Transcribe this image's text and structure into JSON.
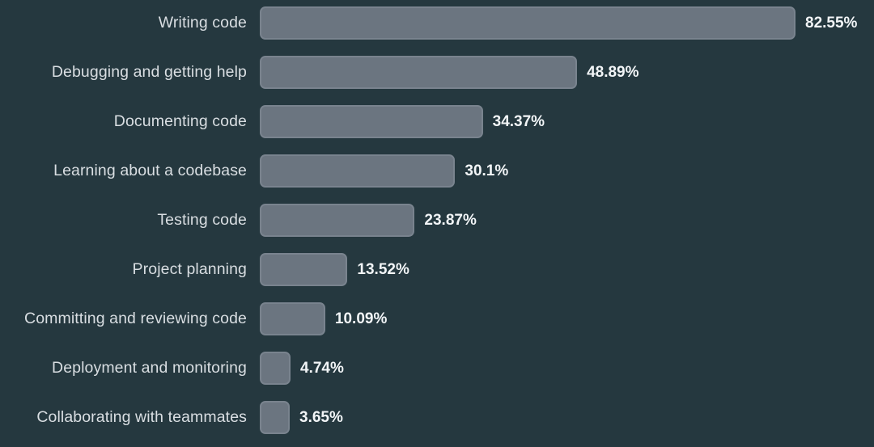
{
  "chart_data": {
    "type": "bar",
    "orientation": "horizontal",
    "title": "",
    "subtitle": "",
    "xlabel": "",
    "ylabel": "",
    "xlim": [
      0,
      82.55
    ],
    "grid": false,
    "legend": null,
    "value_suffix": "%",
    "categories": [
      "Writing code",
      "Debugging and getting help",
      "Documenting code",
      "Learning about a codebase",
      "Testing code",
      "Project planning",
      "Committing and reviewing code",
      "Deployment and monitoring",
      "Collaborating with teammates"
    ],
    "values": [
      82.55,
      48.89,
      34.37,
      30.1,
      23.87,
      13.52,
      10.09,
      4.74,
      3.65
    ],
    "value_labels": [
      "82.55%",
      "48.89%",
      "34.37%",
      "30.1%",
      "23.87%",
      "13.52%",
      "10.09%",
      "4.74%",
      "3.65%"
    ],
    "colors": {
      "background": "#25383f",
      "bar_fill": "#6b7580",
      "bar_border": "#79838e",
      "category_text": "#d9dee2",
      "value_text": "#f2f5f7"
    }
  }
}
